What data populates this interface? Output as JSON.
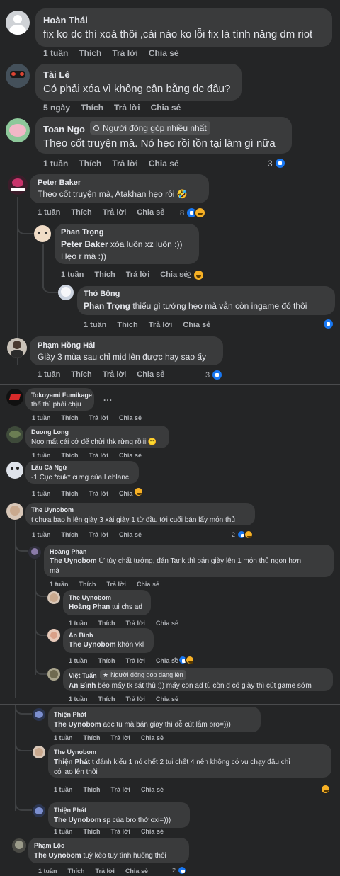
{
  "c1": {
    "name": "Hoàn Thái",
    "text": "fix ko dc thì xoá thôi ,cái nào ko lỗi fix là tính năng dm riot",
    "time": "1 tuần",
    "like": "Thích",
    "reply": "Trả lời",
    "share": "Chia sẻ"
  },
  "c2": {
    "name": "Tài Lê",
    "text": "Có phải xóa vì không cân bằng dc đâu?",
    "time": "5 ngày",
    "like": "Thích",
    "reply": "Trả lời",
    "share": "Chia sẻ"
  },
  "c3": {
    "name": "Toan Ngo",
    "badge": "Người đóng góp nhiều nhất",
    "text": "Theo cốt truyện mà. Nó hẹo rồi tồn tại làm gì nữa",
    "time": "1 tuần",
    "like": "Thích",
    "reply": "Trả lời",
    "share": "Chia sẻ",
    "count": "3"
  },
  "c4": {
    "name": "Peter Baker",
    "text": "Theo cốt truyện mà, Atakhan hẹo rồi 🤣",
    "time": "1 tuần",
    "like": "Thích",
    "reply": "Trả lời",
    "share": "Chia sẻ",
    "count": "8"
  },
  "c5": {
    "name": "Phan Trọng",
    "mention": "Peter Baker",
    "text": " xóa luôn xz luôn :))",
    "text2": "Hẹo r mà :))",
    "time": "1 tuần",
    "like": "Thích",
    "reply": "Trả lời",
    "share": "Chia sẻ",
    "count": "2"
  },
  "c6": {
    "name": "Thỏ Bông",
    "mention": "Phan Trọng",
    "text": " thiếu gì tướng hẹo mà vẫn còn ingame đó thôi",
    "time": "1 tuần",
    "like": "Thích",
    "reply": "Trả lời",
    "share": "Chia sẻ"
  },
  "c7": {
    "name": "Phạm Hồng Hải",
    "text": "Giày 3 mùa sau chỉ mid lên được hay sao ấy",
    "time": "1 tuần",
    "like": "Thích",
    "reply": "Trả lời",
    "share": "Chia sẻ",
    "count": "3"
  },
  "c8": {
    "name": "Tokoyami Fumikage",
    "text": "thế thì phải chịu",
    "time": "1 tuần",
    "like": "Thích",
    "reply": "Trả lời",
    "share": "Chia sẻ",
    "more": "..."
  },
  "c9": {
    "name": "Duong Long",
    "text": "Noo mất cái cớ để chửi thk rừng rồiiii😑",
    "time": "1 tuần",
    "like": "Thích",
    "reply": "Trả lời",
    "share": "Chia sẻ"
  },
  "c10": {
    "name": "Lẩu Cá Ngừ",
    "text": "-1 Cục *cuk* cưng của Leblanc",
    "time": "1 tuần",
    "like": "Thích",
    "reply": "Trả lời",
    "share": "Chia sẻ"
  },
  "c11": {
    "name": "The Uynobom",
    "text": "t chưa bao h lên giày 3 xài giày 1 từ đầu tới cuối bán lấy món thủ",
    "time": "1 tuần",
    "like": "Thích",
    "reply": "Trả lời",
    "share": "Chia sẻ",
    "count": "2"
  },
  "c12": {
    "name": "Hoàng Phan",
    "mention": "The Uynobom",
    "text": " Ừ tùy chất tướng, đán Tank thì bán giày lên 1 món thủ ngon hơn",
    "text2": "mà",
    "time": "1 tuần",
    "like": "Thích",
    "reply": "Trả lời",
    "share": "Chia sẻ"
  },
  "c13": {
    "name": "The Uynobom",
    "mention": "Hoàng Phan",
    "text": " tui chs ad",
    "time": "1 tuần",
    "like": "Thích",
    "reply": "Trả lời",
    "share": "Chia sẻ"
  },
  "c14": {
    "name": "An Bình",
    "mention": "The Uynobom",
    "text": " khôn vkl",
    "time": "1 tuần",
    "like": "Thích",
    "reply": "Trả lời",
    "share": "Chia sẻ",
    "count": "4"
  },
  "c15": {
    "name": "Việt Tuấn",
    "badge": "Người đóng góp đang lên",
    "mention": "An Bình",
    "text": " béo mấy tk sát thủ :)) mấy con ad tù còn đ có giày thì cút game sớm",
    "time": "1 tuần",
    "like": "Thích",
    "reply": "Trả lời",
    "share": "Chia sẻ"
  },
  "c16": {
    "name": "Thiện Phát",
    "mention": "The Uynobom",
    "text": " adc tù mà bán giày thì dễ cút lắm bro=)))",
    "time": "1 tuần",
    "like": "Thích",
    "reply": "Trả lời",
    "share": "Chia sẻ"
  },
  "c17": {
    "name": "The Uynobom",
    "mention": "Thiện Phát",
    "text": " t đánh kiểu 1 nó chết 2 tui chết 4 nên không có vụ chạy đâu chỉ",
    "text2": "có lao lên thôi",
    "time": "1 tuần",
    "like": "Thích",
    "reply": "Trả lời",
    "share": "Chia sẻ"
  },
  "c18": {
    "name": "Thiện Phát",
    "mention": "The Uynobom",
    "text": " sp của bro thở oxi=)))",
    "time": "1 tuần",
    "like": "Thích",
    "reply": "Trả lời",
    "share": "Chia sẻ"
  },
  "c19": {
    "name": "Phạm Lộc",
    "mention": "The Uynobom",
    "text": " tuỳ kèo tuỳ tình huống thôi",
    "time": "1 tuần",
    "like": "Thích",
    "reply": "Trả lời",
    "share": "Chia sẻ",
    "count": "2"
  },
  "colors": {
    "bg": "#242526",
    "bubble": "#3a3b3c",
    "text": "#e4e6eb",
    "muted": "#b0b3b8",
    "like": "#1877f2",
    "haha": "#f7b125"
  }
}
